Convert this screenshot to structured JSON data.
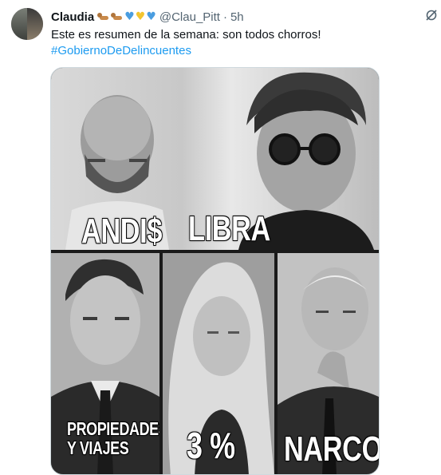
{
  "tweet": {
    "author_name": "Claudia",
    "handle": "@Clau_Pitt",
    "separator": "·",
    "time": "5h",
    "text": "Este es resumen de la semana: son todos chorros!",
    "hashtag": "#GobiernoDeDelincuentes"
  },
  "name_emojis": [
    "dog-emoji",
    "dog-emoji",
    "blue-heart",
    "yellow-heart",
    "blue-heart"
  ],
  "media": {
    "captions": {
      "andis": "ANDI$",
      "libra": "LIBRA",
      "propiedades": "PROPIEDADES\nY VIAJES",
      "percent": "3 %",
      "narco": "NARCO"
    }
  },
  "colors": {
    "link": "#1d9bf0",
    "secondary_text": "#536471",
    "primary_text": "#0f1419"
  },
  "icons": {
    "grok": "grok-icon"
  }
}
